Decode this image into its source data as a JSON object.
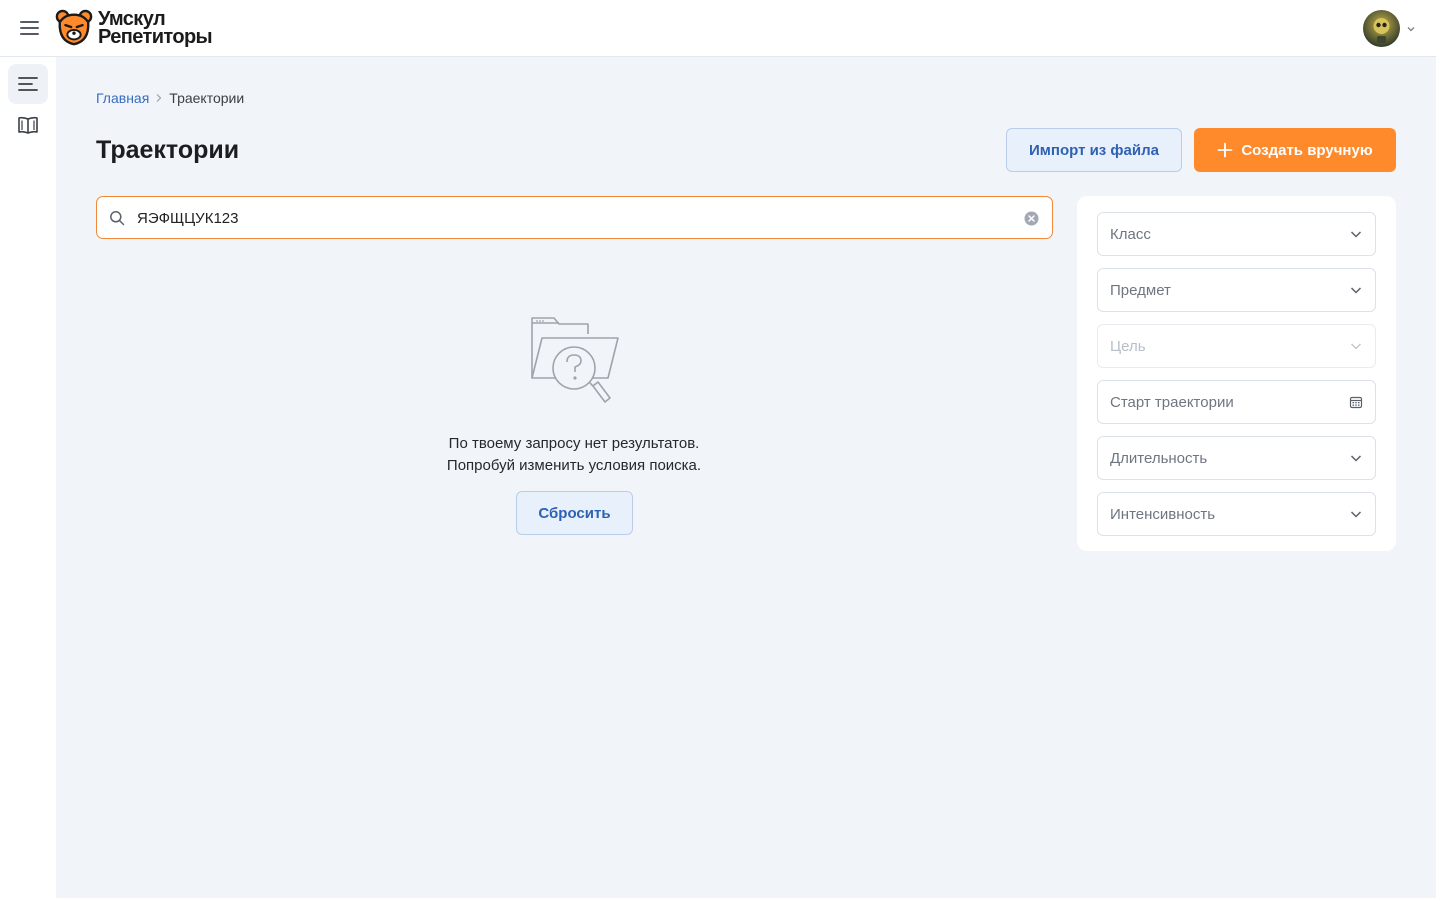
{
  "header": {
    "logo_line1": "Умскул",
    "logo_line2": "Репетиторы"
  },
  "breadcrumb": {
    "home": "Главная",
    "current": "Траектории"
  },
  "page": {
    "title": "Траектории",
    "import_button": "Импорт из файла",
    "create_button": "Создать вручную"
  },
  "search": {
    "value": "ЯЭФЩЦУК123"
  },
  "empty_state": {
    "line1": "По твоему запросу нет результатов.",
    "line2": "Попробуй изменить условия поиска.",
    "reset_button": "Сбросить"
  },
  "filters": {
    "grade": "Класс",
    "subject": "Предмет",
    "goal": "Цель",
    "start": "Старт траектории",
    "duration": "Длительность",
    "intensity": "Интенсивность"
  },
  "colors": {
    "accent": "#ff8a2b",
    "link": "#3a6cc0",
    "background": "#f1f4f9"
  }
}
